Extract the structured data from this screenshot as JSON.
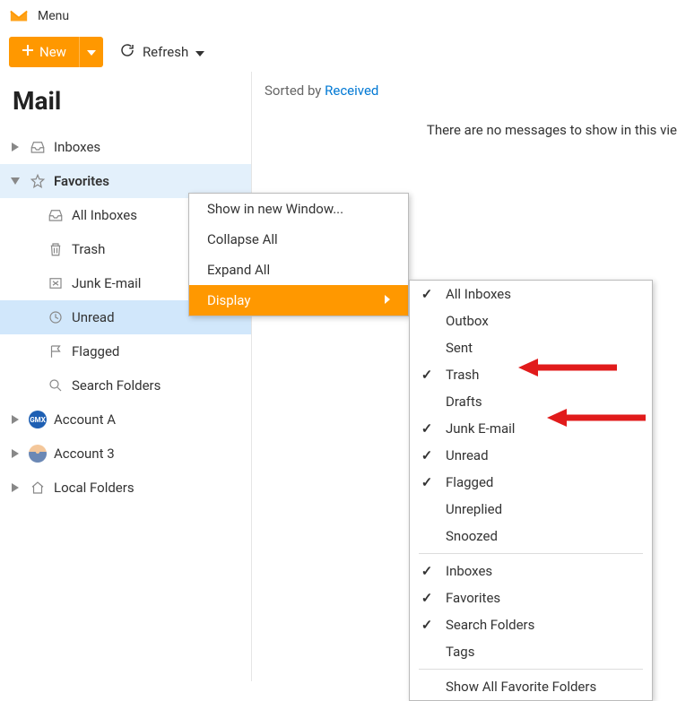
{
  "app": {
    "menu_label": "Menu"
  },
  "toolbar": {
    "new_label": "New",
    "refresh_label": "Refresh"
  },
  "sidebar": {
    "title": "Mail",
    "items": [
      {
        "label": "Inboxes",
        "icon": "inbox",
        "caret": "right"
      },
      {
        "label": "Favorites",
        "icon": "star",
        "caret": "down",
        "style": "favorites"
      },
      {
        "label": "All Inboxes",
        "icon": "inbox",
        "child": true
      },
      {
        "label": "Trash",
        "icon": "trash",
        "child": true
      },
      {
        "label": "Junk E-mail",
        "icon": "junk",
        "child": true
      },
      {
        "label": "Unread",
        "icon": "clock",
        "child": true,
        "selected": true
      },
      {
        "label": "Flagged",
        "icon": "flag",
        "child": true
      },
      {
        "label": "Search Folders",
        "icon": "search",
        "child": true
      },
      {
        "label": "Account A",
        "icon": "gmx",
        "caret": "right"
      },
      {
        "label": "Account 3",
        "icon": "avatar",
        "caret": "right"
      },
      {
        "label": "Local Folders",
        "icon": "home",
        "caret": "right"
      }
    ]
  },
  "content": {
    "sorted_by_prefix": "Sorted by ",
    "sorted_by_value": "Received",
    "empty_message": "There are no messages to show in this vie"
  },
  "context_menu": {
    "items": [
      {
        "label": "Show in new Window...",
        "active": false
      },
      {
        "label": "Collapse All",
        "active": false
      },
      {
        "label": "Expand All",
        "active": false
      },
      {
        "label": "Display",
        "active": true,
        "has_sub": true
      }
    ]
  },
  "display_submenu": {
    "groups": [
      [
        {
          "label": "All Inboxes",
          "checked": true
        },
        {
          "label": "Outbox",
          "checked": false
        },
        {
          "label": "Sent",
          "checked": false
        },
        {
          "label": "Trash",
          "checked": true
        },
        {
          "label": "Drafts",
          "checked": false
        },
        {
          "label": "Junk E-mail",
          "checked": true
        },
        {
          "label": "Unread",
          "checked": true
        },
        {
          "label": "Flagged",
          "checked": true
        },
        {
          "label": "Unreplied",
          "checked": false
        },
        {
          "label": "Snoozed",
          "checked": false
        }
      ],
      [
        {
          "label": "Inboxes",
          "checked": true
        },
        {
          "label": "Favorites",
          "checked": true
        },
        {
          "label": "Search Folders",
          "checked": true
        },
        {
          "label": "Tags",
          "checked": false
        }
      ],
      [
        {
          "label": "Show All Favorite Folders",
          "checked": false
        }
      ]
    ]
  },
  "icons": {
    "inbox": "inbox-icon",
    "star": "star-icon",
    "trash": "trash-icon",
    "junk": "junk-icon",
    "clock": "clock-icon",
    "flag": "flag-icon",
    "search": "search-icon",
    "home": "home-icon"
  },
  "colors": {
    "accent": "#ff9800",
    "link": "#0078d4",
    "selected_bg": "#d1e7fb",
    "arrow": "#e11b1b"
  }
}
